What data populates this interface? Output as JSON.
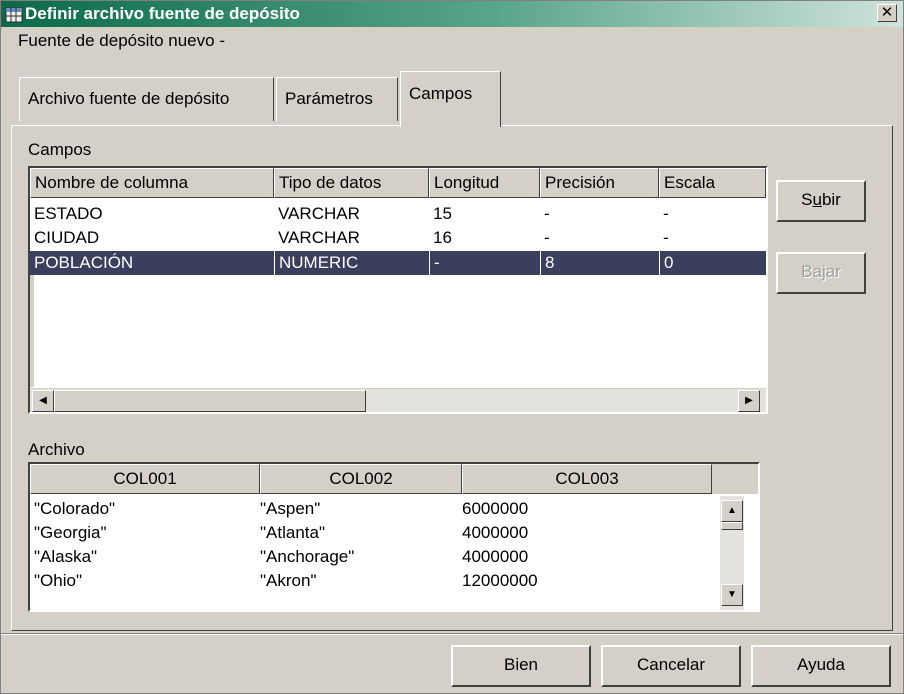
{
  "window": {
    "title": "Definir archivo fuente de depósito",
    "close_glyph": "✕",
    "subtitle": "Fuente de depósito nuevo -"
  },
  "tabs": [
    {
      "label": "Archivo fuente de depósito",
      "active": false
    },
    {
      "label": "Parámetros",
      "active": false
    },
    {
      "label": "Campos",
      "active": true
    }
  ],
  "campos": {
    "group_label": "Campos",
    "columns": [
      "Nombre de columna",
      "Tipo de datos",
      "Longitud",
      "Precisión",
      "Escala"
    ],
    "rows": [
      [
        "ESTADO",
        "VARCHAR",
        "15",
        "-",
        "-"
      ],
      [
        "CIUDAD",
        "VARCHAR",
        "16",
        "-",
        "-"
      ],
      [
        "POBLACIÓN",
        "NUMERIC",
        "-",
        "8",
        "0"
      ]
    ],
    "selected_row": 2
  },
  "side_buttons": {
    "subir": {
      "pre": "S",
      "mnemonic": "u",
      "post": "bir",
      "enabled": true
    },
    "bajar": {
      "pre": "Ba",
      "mnemonic": "j",
      "post": "ar",
      "enabled": false
    }
  },
  "archivo": {
    "group_label": "Archivo",
    "columns": [
      "COL001",
      "COL002",
      "COL003"
    ],
    "rows": [
      [
        "\"Colorado\"",
        "\"Aspen\"",
        "6000000"
      ],
      [
        "\"Georgia\"",
        "\"Atlanta\"",
        "4000000"
      ],
      [
        "\"Alaska\"",
        "\"Anchorage\"",
        "4000000"
      ],
      [
        "\"Ohio\"",
        "\"Akron\"",
        "12000000"
      ]
    ]
  },
  "footer": {
    "ok": "Bien",
    "cancel": "Cancelar",
    "help": "Ayuda"
  },
  "colors": {
    "title_gradient_start": "#0a6a4a",
    "selection": "#3a3f5e",
    "face": "#d4d0c8"
  },
  "icons": {
    "app": "table-icon",
    "close": "close-icon",
    "scroll_left": "arrow-left-icon",
    "scroll_right": "arrow-right-icon",
    "scroll_up": "arrow-up-icon",
    "scroll_down": "arrow-down-icon"
  }
}
